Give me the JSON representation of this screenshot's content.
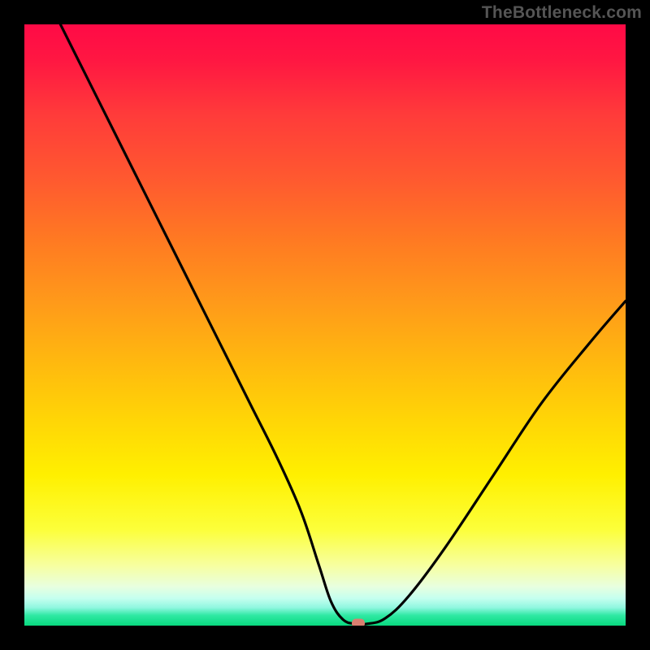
{
  "watermark": "TheBottleneck.com",
  "chart_data": {
    "type": "line",
    "title": "",
    "xlabel": "",
    "ylabel": "",
    "xlim": [
      0,
      100
    ],
    "ylim": [
      0,
      100
    ],
    "grid": false,
    "legend": false,
    "background_gradient": {
      "top": "#ff0a46",
      "upper_mid": "#ff991a",
      "mid": "#fff000",
      "lower_mid": "#f7ffa0",
      "bottom": "#08d97f"
    },
    "series": [
      {
        "name": "bottleneck-curve",
        "color": "#000000",
        "x": [
          6,
          10,
          14,
          18,
          22,
          26,
          30,
          34,
          38,
          42,
          46,
          49,
          51,
          53,
          55,
          57,
          60,
          64,
          70,
          78,
          86,
          94,
          100
        ],
        "y": [
          100,
          92,
          84,
          76,
          68,
          60,
          52,
          44,
          36,
          28,
          19,
          10,
          4,
          1,
          0.3,
          0.3,
          1.2,
          5,
          13,
          25,
          37,
          47,
          54
        ]
      }
    ],
    "marker": {
      "x": 55.5,
      "y": 0.4,
      "color": "#d97f70"
    }
  }
}
